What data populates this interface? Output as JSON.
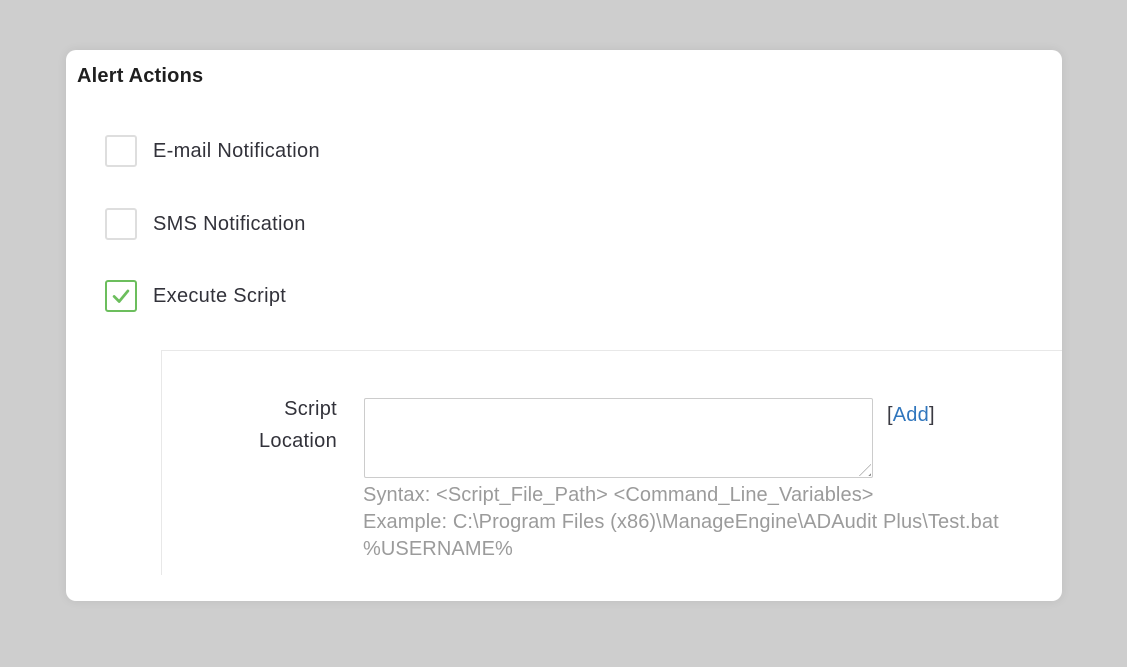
{
  "page": {
    "background_color": "#cecece",
    "card_background": "#ffffff"
  },
  "alert_actions": {
    "title": "Alert Actions",
    "checkboxes": [
      {
        "label": "E-mail Notification",
        "checked": false
      },
      {
        "label": "SMS Notification",
        "checked": false
      },
      {
        "label": "Execute Script",
        "checked": true
      }
    ]
  },
  "script_section": {
    "field_label": "Script Location",
    "textarea_value": "",
    "add_link": {
      "open_bracket": "[",
      "label": "Add",
      "close_bracket": "]"
    },
    "hint_lines": [
      "Syntax: <Script_File_Path> <Command_Line_Variables>",
      "Example: C:\\Program Files (x86)\\ManageEngine\\ADAudit Plus\\Test.bat",
      "%USERNAME%"
    ]
  },
  "colors": {
    "checkbox_checked_accent": "#6cbe5d",
    "checkbox_unchecked_border": "#dedede",
    "link_blue": "#3076bd",
    "hint_gray": "#9b9b9b",
    "panel_border": "#e8e8e8",
    "heading_text": "#1f1f1f",
    "label_text": "#32323a"
  }
}
